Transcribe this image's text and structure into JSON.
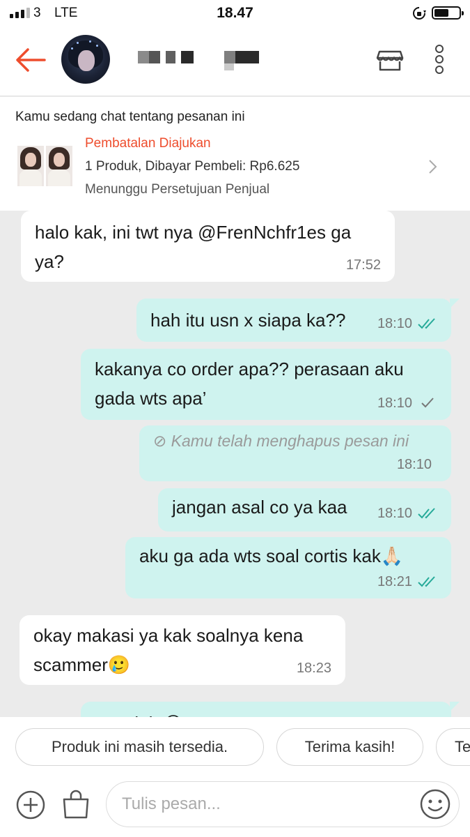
{
  "status_bar": {
    "carrier": "3",
    "network": "LTE",
    "time": "18.47"
  },
  "header": {
    "contact_name_hidden": true
  },
  "order": {
    "intro": "Kamu sedang chat tentang pesanan ini",
    "status": "Pembatalan Diajukan",
    "detail": "1 Produk, Dibayar Pembeli: Rp6.625",
    "note": "Menunggu Persetujuan Penjual"
  },
  "messages": [
    {
      "from": "seller",
      "lines": [
        "halo kak, ini twt nya @FrenNchfr1es ga",
        "ya?"
      ],
      "time": "17:52"
    },
    {
      "from": "me",
      "lines": [
        "hah itu usn x siapa ka??"
      ],
      "time": "18:10",
      "ticks": "read"
    },
    {
      "from": "me",
      "lines": [
        "kakanya co order apa?? perasaan aku",
        "gada wts apa’"
      ],
      "time": "18:10",
      "ticks": "sent"
    },
    {
      "from": "me",
      "lines": [
        "⊘ Kamu telah menghapus pesan ini"
      ],
      "time": "18:10",
      "deleted": true
    },
    {
      "from": "me",
      "lines": [
        "jangan asal co ya kaa"
      ],
      "time": "18:10",
      "ticks": "read"
    },
    {
      "from": "me",
      "lines": [
        "aku ga ada wts soal cortis kak🙏🏻"
      ],
      "time": "18:21",
      "ticks": "read"
    },
    {
      "from": "seller",
      "lines": [
        "okay makasi ya kak soalnya kena",
        "scammer🥲"
      ],
      "time": "18:23"
    },
    {
      "from": "me",
      "lines": [
        "Alah 😅 ..."
      ],
      "partial": true
    }
  ],
  "quick_replies": [
    "Produk ini masih tersedia.",
    "Terima kasih!",
    "Te"
  ],
  "composer": {
    "placeholder": "Tulis pesan..."
  },
  "colors": {
    "accent": "#ee4d2d",
    "bubble_out": "#cff3ef",
    "bubble_in": "#ffffff",
    "tick": "#26aa99"
  }
}
